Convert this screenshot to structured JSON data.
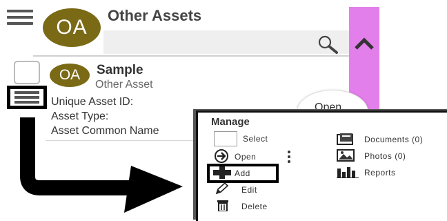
{
  "header": {
    "title": "Other Assets",
    "avatar_initials": "OA"
  },
  "asset_item": {
    "avatar_initials": "OA",
    "name": "Sample",
    "type_label": "Other Asset",
    "fields": [
      "Unique Asset ID:",
      "Asset Type:",
      "Asset Common Name"
    ]
  },
  "open_button_label": "Open",
  "manage_menu": {
    "title": "Manage",
    "select_label": "Select",
    "open_label": "Open",
    "add_label": "Add",
    "edit_label": "Edit",
    "delete_label": "Delete",
    "documents_label": "Documents (0)",
    "photos_label": "Photos (0)",
    "reports_label": "Reports"
  },
  "colors": {
    "avatar": "#7a6a16",
    "side_bar": "#e27fea",
    "highlight_border": "#000000"
  },
  "icons": {
    "menu": "hamburger-icon",
    "search": "search-icon",
    "collapse": "chevron-up-icon",
    "open": "arrow-circle-right-icon",
    "more": "kebab-icon",
    "add": "plus-icon",
    "edit": "pencil-icon",
    "delete": "trash-icon",
    "documents": "folder-icon",
    "photos": "photo-icon",
    "reports": "bar-chart-icon"
  }
}
